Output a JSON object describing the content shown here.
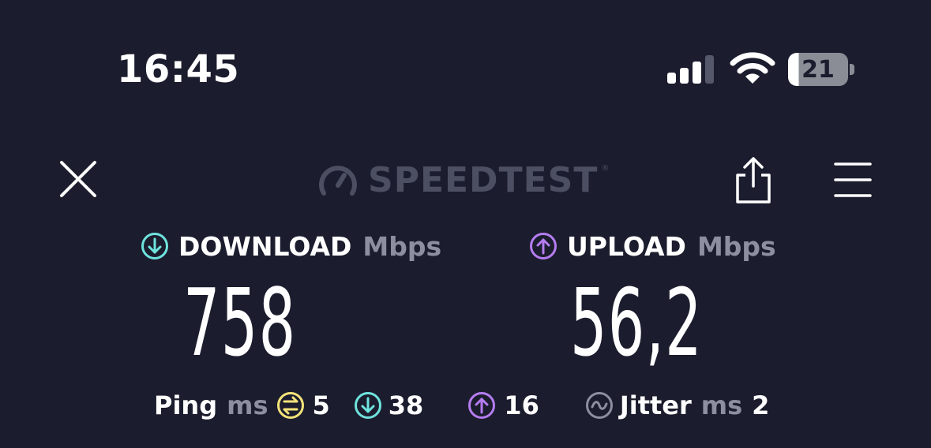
{
  "status_bar": {
    "time": "16:45",
    "battery_percent": "21",
    "battery_level": 0.21,
    "signal_bars_active": 3,
    "signal_bars_total": 4
  },
  "header": {
    "logo_text": "SPEEDTEST",
    "logo_tm": "®",
    "icons": [
      "close-icon",
      "speedometer-icon",
      "share-icon",
      "menu-icon"
    ]
  },
  "download": {
    "label": "DOWNLOAD",
    "unit": "Mbps",
    "value": "758",
    "color": "#6fe3dd"
  },
  "upload": {
    "label": "UPLOAD",
    "unit": "Mbps",
    "value": "56,2",
    "color": "#b57cf0"
  },
  "ping": {
    "label": "Ping",
    "unit": "ms",
    "idle": "5",
    "idle_color": "#f4e27a",
    "download": "38",
    "upload": "16"
  },
  "jitter": {
    "label": "Jitter",
    "unit": "ms",
    "value": "2",
    "color": "#8d8fa0"
  }
}
